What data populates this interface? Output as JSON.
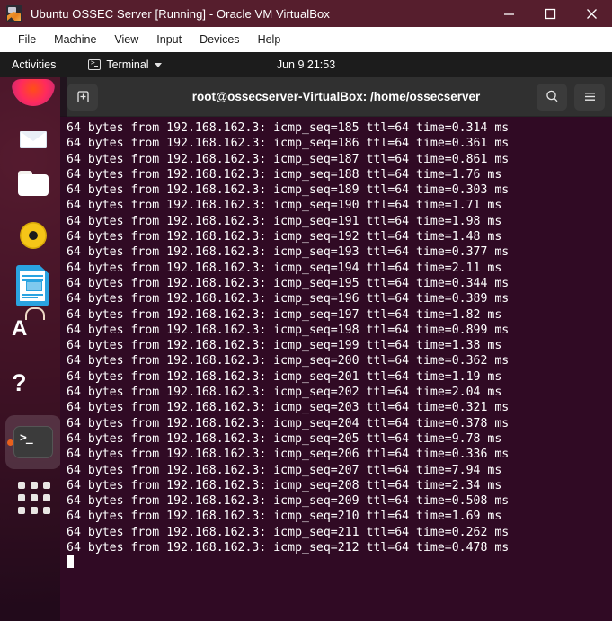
{
  "vbox_window": {
    "icon": "virtualbox-icon",
    "title": "Ubuntu OSSEC Server [Running] - Oracle VM VirtualBox",
    "controls": [
      {
        "name": "minimize",
        "glyph": "minimize-icon"
      },
      {
        "name": "maximize",
        "glyph": "maximize-icon"
      },
      {
        "name": "close",
        "glyph": "close-icon"
      }
    ],
    "menubar": [
      "File",
      "Machine",
      "View",
      "Input",
      "Devices",
      "Help"
    ]
  },
  "gnome_topbar": {
    "activities": "Activities",
    "app_menu": {
      "label": "Terminal",
      "icon": "terminal-icon",
      "arrow": "chevron-down-icon"
    },
    "clock": "Jun 9  21:53"
  },
  "dock": {
    "items": [
      {
        "name": "firefox",
        "label": "Firefox",
        "icon": "firefox-icon",
        "active": false
      },
      {
        "name": "thunderbird",
        "label": "Thunderbird Mail",
        "icon": "thunderbird-icon",
        "active": false
      },
      {
        "name": "files",
        "label": "Files",
        "icon": "files-icon",
        "active": false
      },
      {
        "name": "rhythmbox",
        "label": "Rhythmbox",
        "icon": "rhythmbox-icon",
        "active": false
      },
      {
        "name": "impress",
        "label": "LibreOffice Impress",
        "icon": "libreoffice-impress-icon",
        "active": false
      },
      {
        "name": "software",
        "label": "Ubuntu Software",
        "icon": "ubuntu-software-icon",
        "active": false
      },
      {
        "name": "help",
        "label": "Help",
        "icon": "help-icon",
        "active": false
      },
      {
        "name": "terminal",
        "label": "Terminal",
        "icon": "terminal-icon",
        "active": true
      }
    ],
    "show_apps": {
      "label": "Show Applications",
      "icon": "app-grid-icon"
    }
  },
  "terminal": {
    "header": {
      "new_tab": "new-tab-icon",
      "title": "root@ossecserver-VirtualBox: /home/ossecserver",
      "search": "search-icon",
      "menu": "hamburger-menu-icon"
    },
    "lines": [
      "64 bytes from 192.168.162.3: icmp_seq=185 ttl=64 time=0.314 ms",
      "64 bytes from 192.168.162.3: icmp_seq=186 ttl=64 time=0.361 ms",
      "64 bytes from 192.168.162.3: icmp_seq=187 ttl=64 time=0.861 ms",
      "64 bytes from 192.168.162.3: icmp_seq=188 ttl=64 time=1.76 ms",
      "64 bytes from 192.168.162.3: icmp_seq=189 ttl=64 time=0.303 ms",
      "64 bytes from 192.168.162.3: icmp_seq=190 ttl=64 time=1.71 ms",
      "64 bytes from 192.168.162.3: icmp_seq=191 ttl=64 time=1.98 ms",
      "64 bytes from 192.168.162.3: icmp_seq=192 ttl=64 time=1.48 ms",
      "64 bytes from 192.168.162.3: icmp_seq=193 ttl=64 time=0.377 ms",
      "64 bytes from 192.168.162.3: icmp_seq=194 ttl=64 time=2.11 ms",
      "64 bytes from 192.168.162.3: icmp_seq=195 ttl=64 time=0.344 ms",
      "64 bytes from 192.168.162.3: icmp_seq=196 ttl=64 time=0.389 ms",
      "64 bytes from 192.168.162.3: icmp_seq=197 ttl=64 time=1.82 ms",
      "64 bytes from 192.168.162.3: icmp_seq=198 ttl=64 time=0.899 ms",
      "64 bytes from 192.168.162.3: icmp_seq=199 ttl=64 time=1.38 ms",
      "64 bytes from 192.168.162.3: icmp_seq=200 ttl=64 time=0.362 ms",
      "64 bytes from 192.168.162.3: icmp_seq=201 ttl=64 time=1.19 ms",
      "64 bytes from 192.168.162.3: icmp_seq=202 ttl=64 time=2.04 ms",
      "64 bytes from 192.168.162.3: icmp_seq=203 ttl=64 time=0.321 ms",
      "64 bytes from 192.168.162.3: icmp_seq=204 ttl=64 time=0.378 ms",
      "64 bytes from 192.168.162.3: icmp_seq=205 ttl=64 time=9.78 ms",
      "64 bytes from 192.168.162.3: icmp_seq=206 ttl=64 time=0.336 ms",
      "64 bytes from 192.168.162.3: icmp_seq=207 ttl=64 time=7.94 ms",
      "64 bytes from 192.168.162.3: icmp_seq=208 ttl=64 time=2.34 ms",
      "64 bytes from 192.168.162.3: icmp_seq=209 ttl=64 time=0.508 ms",
      "64 bytes from 192.168.162.3: icmp_seq=210 ttl=64 time=1.69 ms",
      "64 bytes from 192.168.162.3: icmp_seq=211 ttl=64 time=0.262 ms",
      "64 bytes from 192.168.162.3: icmp_seq=212 ttl=64 time=0.478 ms"
    ]
  },
  "colors": {
    "titlebar": "#561e2d",
    "menubar": "#ffffff",
    "topbar": "#1c1c1c",
    "terminal_bg": "#300a24",
    "header_bg": "#303030",
    "accent_orange": "#e8601c"
  }
}
